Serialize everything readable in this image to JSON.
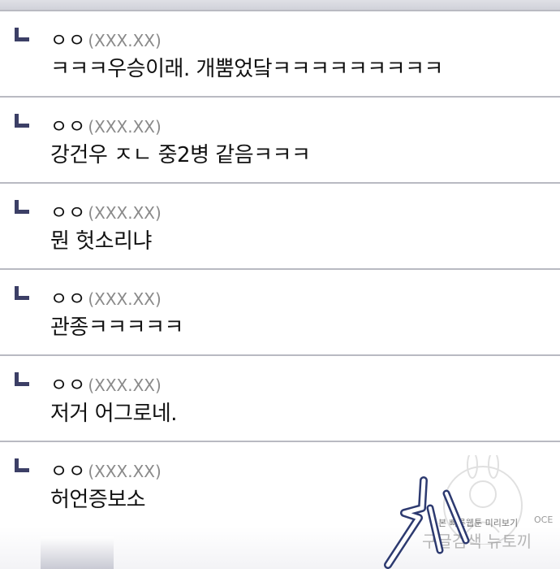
{
  "replies": [
    {
      "author": "ㅇㅇ",
      "ip": "(XXX.XX)",
      "text": "ㅋㅋㅋ우승이래. 개뿜었닼ㅋㅋㅋㅋㅋㅋㅋㅋㅋ"
    },
    {
      "author": "ㅇㅇ",
      "ip": "(XXX.XX)",
      "text": "강건우 ㅈㄴ 중2병 같음ㅋㅋㅋ"
    },
    {
      "author": "ㅇㅇ",
      "ip": "(XXX.XX)",
      "text": "뭔 헛소리냐"
    },
    {
      "author": "ㅇㅇ",
      "ip": "(XXX.XX)",
      "text": "관종ㅋㅋㅋㅋㅋ"
    },
    {
      "author": "ㅇㅇ",
      "ip": "(XXX.XX)",
      "text": "저거 어그로네."
    },
    {
      "author": "ㅇㅇ",
      "ip": "(XXX.XX)",
      "text": "허언증보소"
    }
  ],
  "watermark": {
    "line1": "본 빠른웹툰 미리보기",
    "line2": "구글검색 뉴토끼",
    "corner": "OCE"
  },
  "colors": {
    "reply_arrow": "#3c3f66",
    "divider": "#b9bac2",
    "ip_text": "#8a8a8a"
  }
}
